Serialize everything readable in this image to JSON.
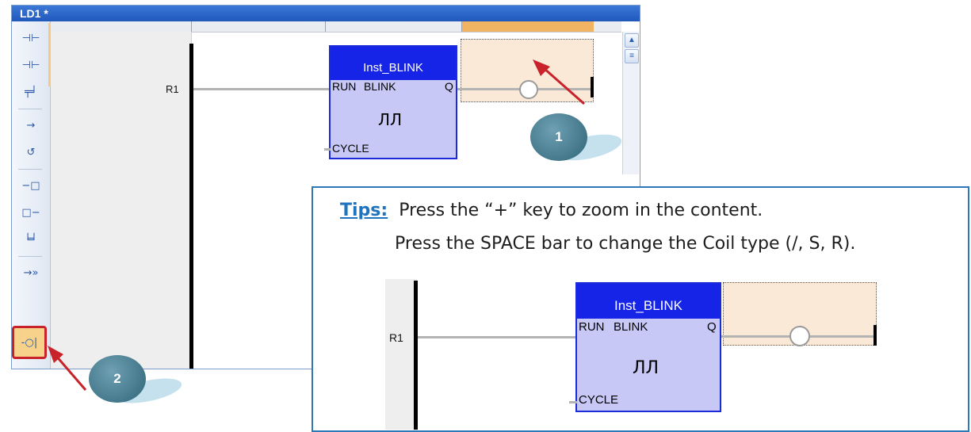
{
  "window": {
    "title": "LD1 *"
  },
  "toolbar": {
    "items": [
      {
        "name": "contact-left-icon",
        "glyph": "⊣⊢"
      },
      {
        "name": "contact-right-icon",
        "glyph": "⊣⊢"
      },
      {
        "name": "parallel-contact-icon",
        "glyph": "╤╛"
      },
      {
        "name": "horizontal-line-icon",
        "glyph": "→"
      },
      {
        "name": "loop-icon",
        "glyph": "↺"
      },
      {
        "name": "block-left-icon",
        "glyph": "−□"
      },
      {
        "name": "block-right-icon",
        "glyph": "□−"
      },
      {
        "name": "parallel-block-icon",
        "glyph": "╘╛"
      },
      {
        "name": "jump-icon",
        "glyph": "→»"
      },
      {
        "name": "coil-icon",
        "glyph": "-○|"
      }
    ]
  },
  "diagram": {
    "rung_label": "R1",
    "function_block": {
      "instance": "Inst_BLINK",
      "input_run": "RUN",
      "type": "BLINK",
      "output": "Q",
      "input_cycle": "CYCLE",
      "symbol": "ЛЛ"
    }
  },
  "callouts": {
    "step1": "1",
    "step2": "2"
  },
  "tips": {
    "label": "Tips:",
    "line1": "Press the “+” key to zoom in the content.",
    "line2": "Press the SPACE bar to change the Coil type (/, S, R)."
  },
  "zoom_view": {
    "rung_label": "R1",
    "function_block": {
      "instance": "Inst_BLINK",
      "input_run": "RUN",
      "type": "BLINK",
      "output": "Q",
      "input_cycle": "CYCLE",
      "symbol": "ЛЛ"
    }
  },
  "colors": {
    "accent": "#c8232a",
    "title_bar": "#2a62c8",
    "fb_fill": "#c7c8f5",
    "fb_header": "#1524e6",
    "tips_border": "#2d79b8"
  }
}
